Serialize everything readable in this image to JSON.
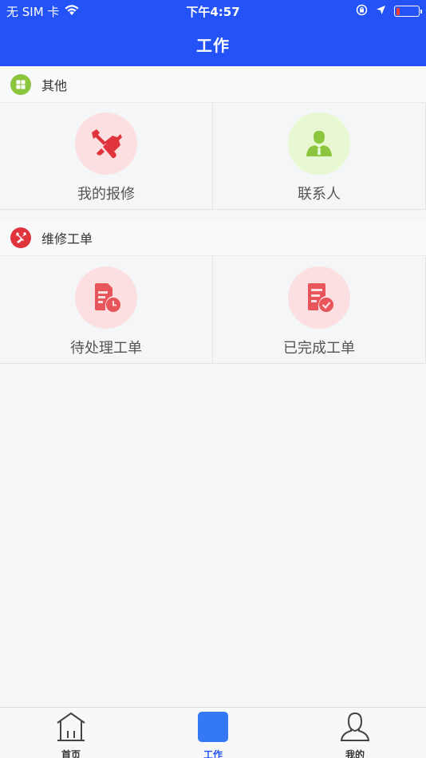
{
  "status_bar": {
    "carrier": "无 SIM 卡",
    "time": "下午4:57",
    "battery_level": 0.18
  },
  "nav": {
    "title": "工作"
  },
  "sections": [
    {
      "title": "其他",
      "icon": "grid-icon",
      "icon_color": "#8cc63f",
      "items": [
        {
          "label": "我的报修",
          "icon": "repair-tools-icon",
          "bg": "#fbdfe1",
          "color": "#e0343c"
        },
        {
          "label": "联系人",
          "icon": "contact-person-icon",
          "bg": "#e8f8d3",
          "color": "#8cc63f"
        }
      ]
    },
    {
      "title": "维修工单",
      "icon": "tools-icon",
      "icon_color": "#e0343c",
      "items": [
        {
          "label": "待处理工单",
          "icon": "pending-document-icon",
          "bg": "#fbdfe1",
          "color": "#e8565c"
        },
        {
          "label": "已完成工单",
          "icon": "completed-document-icon",
          "bg": "#fbdfe1",
          "color": "#e8565c"
        }
      ]
    }
  ],
  "tabs": [
    {
      "label": "首页",
      "icon": "home-icon",
      "active": false
    },
    {
      "label": "工作",
      "icon": "work-icon",
      "active": true
    },
    {
      "label": "我的",
      "icon": "profile-icon",
      "active": false
    }
  ],
  "colors": {
    "primary": "#2352f7",
    "background": "#f5f6f8"
  }
}
